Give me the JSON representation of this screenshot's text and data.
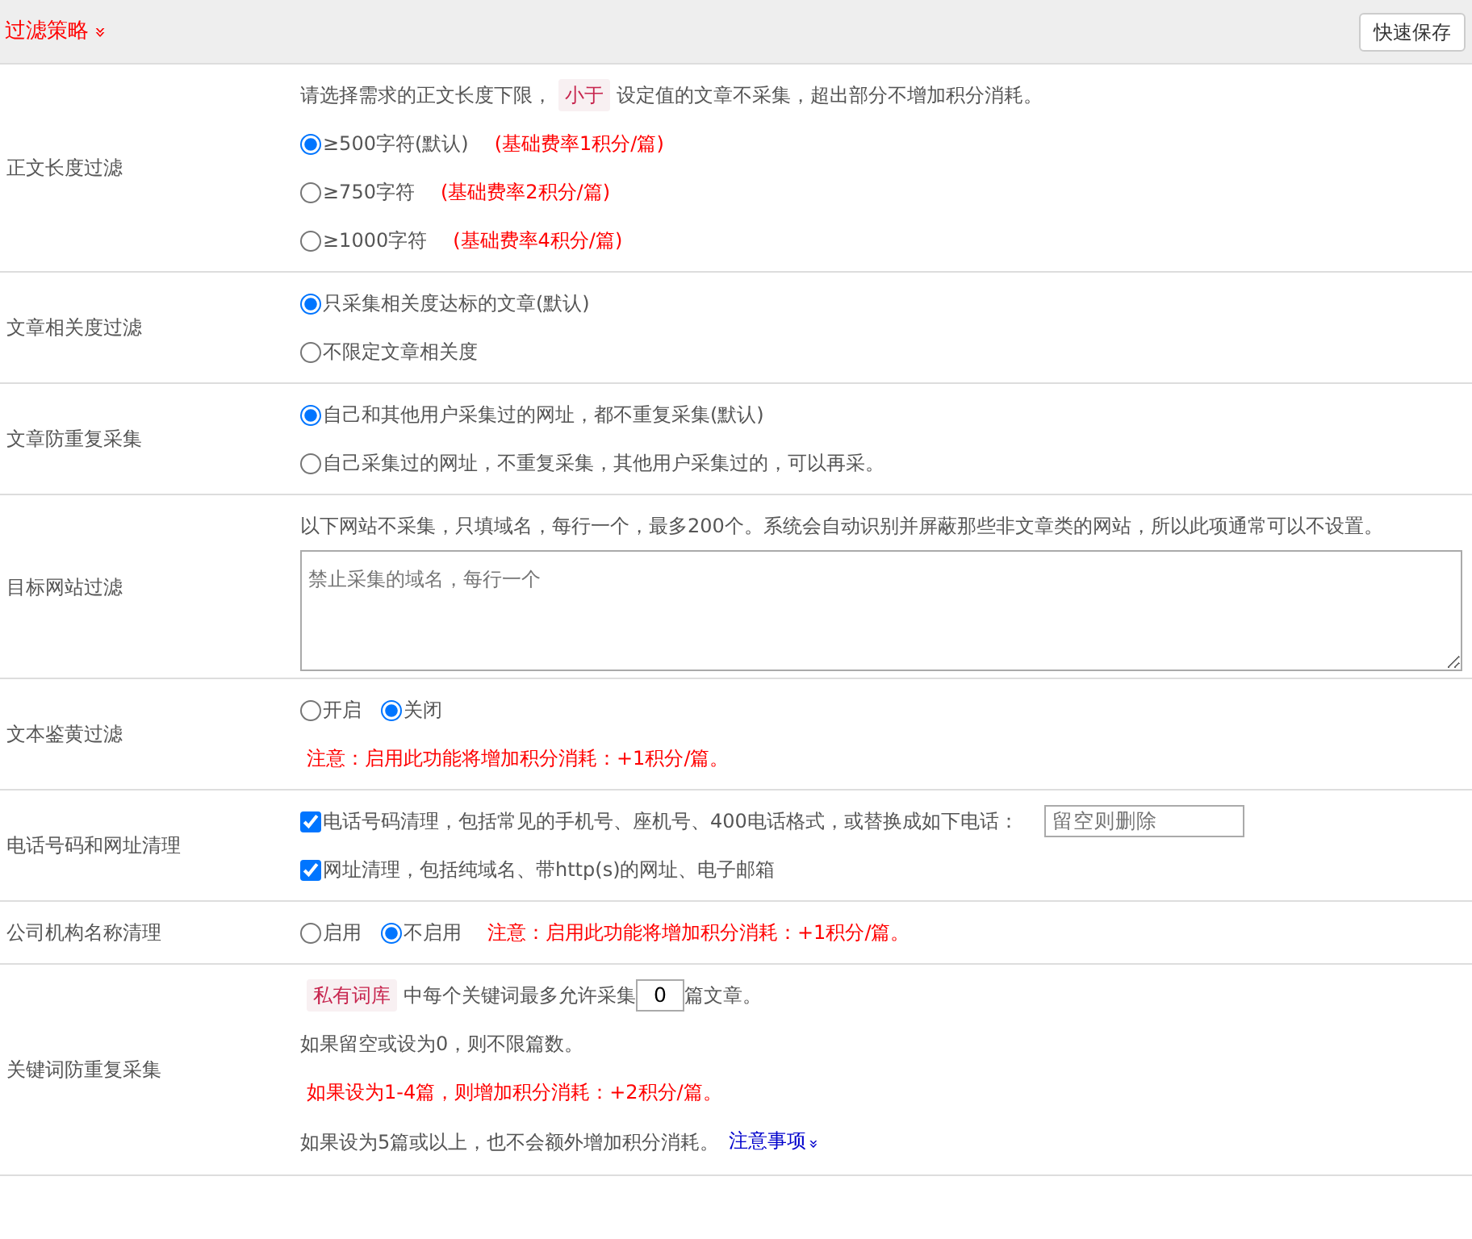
{
  "header": {
    "title": "过滤策略",
    "toggle": "»",
    "button": "快速保存"
  },
  "rows": [
    {
      "label": "正文长度过滤",
      "lines": [
        [
          {
            "kind": "text",
            "text": "请选择需求的正文长度下限，"
          },
          {
            "kind": "tag",
            "text": "小于"
          },
          {
            "kind": "text",
            "text": "设定值的文章不采集，超出部分不增加积分消耗。"
          }
        ],
        [
          {
            "kind": "radio",
            "text": "≥500字符(默认)",
            "selected": true
          },
          {
            "kind": "note",
            "text": "(基础费率1积分/篇)"
          }
        ],
        [
          {
            "kind": "radio",
            "text": "≥750字符",
            "selected": false
          },
          {
            "kind": "note",
            "text": "(基础费率2积分/篇)"
          }
        ],
        [
          {
            "kind": "radio",
            "text": "≥1000字符",
            "selected": false
          },
          {
            "kind": "note",
            "text": "(基础费率4积分/篇)"
          }
        ]
      ]
    },
    {
      "label": "文章相关度过滤",
      "lines": [
        [
          {
            "kind": "radio",
            "text": "只采集相关度达标的文章(默认)",
            "selected": true
          }
        ],
        [
          {
            "kind": "radio",
            "text": "不限定文章相关度",
            "selected": false
          }
        ]
      ]
    },
    {
      "label": "文章防重复采集",
      "lines": [
        [
          {
            "kind": "radio",
            "text": "自己和其他用户采集过的网址，都不重复采集(默认)",
            "selected": true
          }
        ],
        [
          {
            "kind": "radio",
            "text": "自己采集过的网址，不重复采集，其他用户采集过的，可以再采。",
            "selected": false
          }
        ]
      ]
    },
    {
      "label": "目标网站过滤",
      "lines": [
        [
          {
            "kind": "text",
            "text": "以下网站不采集，只填域名，每行一个，最多200个。系统会自动识别并屏蔽那些非文章类的网站，所以此项通常可以不设置。"
          }
        ],
        [
          {
            "kind": "textarea",
            "placeholder": "禁止采集的域名，每行一个"
          }
        ]
      ]
    },
    {
      "label": "文本鉴黄过滤",
      "lines": [
        [
          {
            "kind": "radio",
            "text": "开启",
            "selected": false
          },
          {
            "kind": "radio",
            "text": "关闭",
            "selected": true
          }
        ],
        [
          {
            "kind": "note",
            "text": "注意：启用此功能将增加积分消耗：+1积分/篇。"
          }
        ]
      ]
    },
    {
      "label": "电话号码和网址清理",
      "lines": [
        [
          {
            "kind": "checkbox",
            "text": "电话号码清理，包括常见的手机号、座机号、400电话格式，或替换成如下电话：",
            "checked": true
          },
          {
            "kind": "input",
            "placeholder": "留空则删除"
          }
        ],
        [
          {
            "kind": "checkbox",
            "text": "网址清理，包括纯域名、带http(s)的网址、电子邮箱",
            "checked": true
          }
        ]
      ]
    },
    {
      "label": "公司机构名称清理",
      "lines": [
        [
          {
            "kind": "radio",
            "text": "启用",
            "selected": false
          },
          {
            "kind": "radio",
            "text": "不启用",
            "selected": true
          },
          {
            "kind": "note",
            "text": "注意：启用此功能将增加积分消耗：+1积分/篇。"
          }
        ]
      ]
    },
    {
      "label": "关键词防重复采集",
      "lines": [
        [
          {
            "kind": "tag",
            "text": "私有词库"
          },
          {
            "kind": "text",
            "text": "中每个关键词最多允许采集"
          },
          {
            "kind": "number",
            "value": "0"
          },
          {
            "kind": "text",
            "text": "篇文章。"
          }
        ],
        [
          {
            "kind": "text",
            "text": "如果留空或设为0，则不限篇数。"
          }
        ],
        [
          {
            "kind": "note",
            "text": "如果设为1-4篇，则增加积分消耗：+2积分/篇。"
          }
        ],
        [
          {
            "kind": "text",
            "text": "如果设为5篇或以上，也不会额外增加积分消耗。"
          },
          {
            "kind": "link",
            "text": "注意事项",
            "caret": "»"
          }
        ]
      ]
    }
  ]
}
